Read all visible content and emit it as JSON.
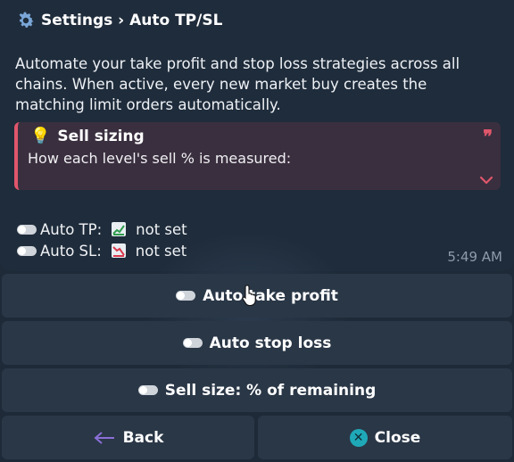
{
  "header": {
    "title": "Settings › Auto TP/SL",
    "icon": "gear-icon"
  },
  "message": {
    "description": "Automate your take profit and stop loss strategies across all chains. When active, every new market buy creates the matching limit orders automatically.",
    "quote": {
      "title": "Sell sizing",
      "icon": "lightbulb-icon",
      "text": "How each level's sell % is measured:",
      "accent_color": "#e0566b"
    },
    "status": [
      {
        "label": "Auto TP:",
        "icon": "chart-up-icon",
        "value": "not set"
      },
      {
        "label": "Auto SL:",
        "icon": "chart-down-icon",
        "value": "not set"
      }
    ],
    "time": "5:49 AM"
  },
  "keyboard": {
    "auto_take_profit": "Auto take profit",
    "auto_stop_loss": "Auto stop loss",
    "sell_size": "Sell size: % of remaining",
    "back": "Back",
    "close": "Close"
  },
  "colors": {
    "background": "#1e2a38",
    "button": "#2a3747",
    "close_icon": "#1fa9b8",
    "back_arrow": "#8a6fd6"
  }
}
